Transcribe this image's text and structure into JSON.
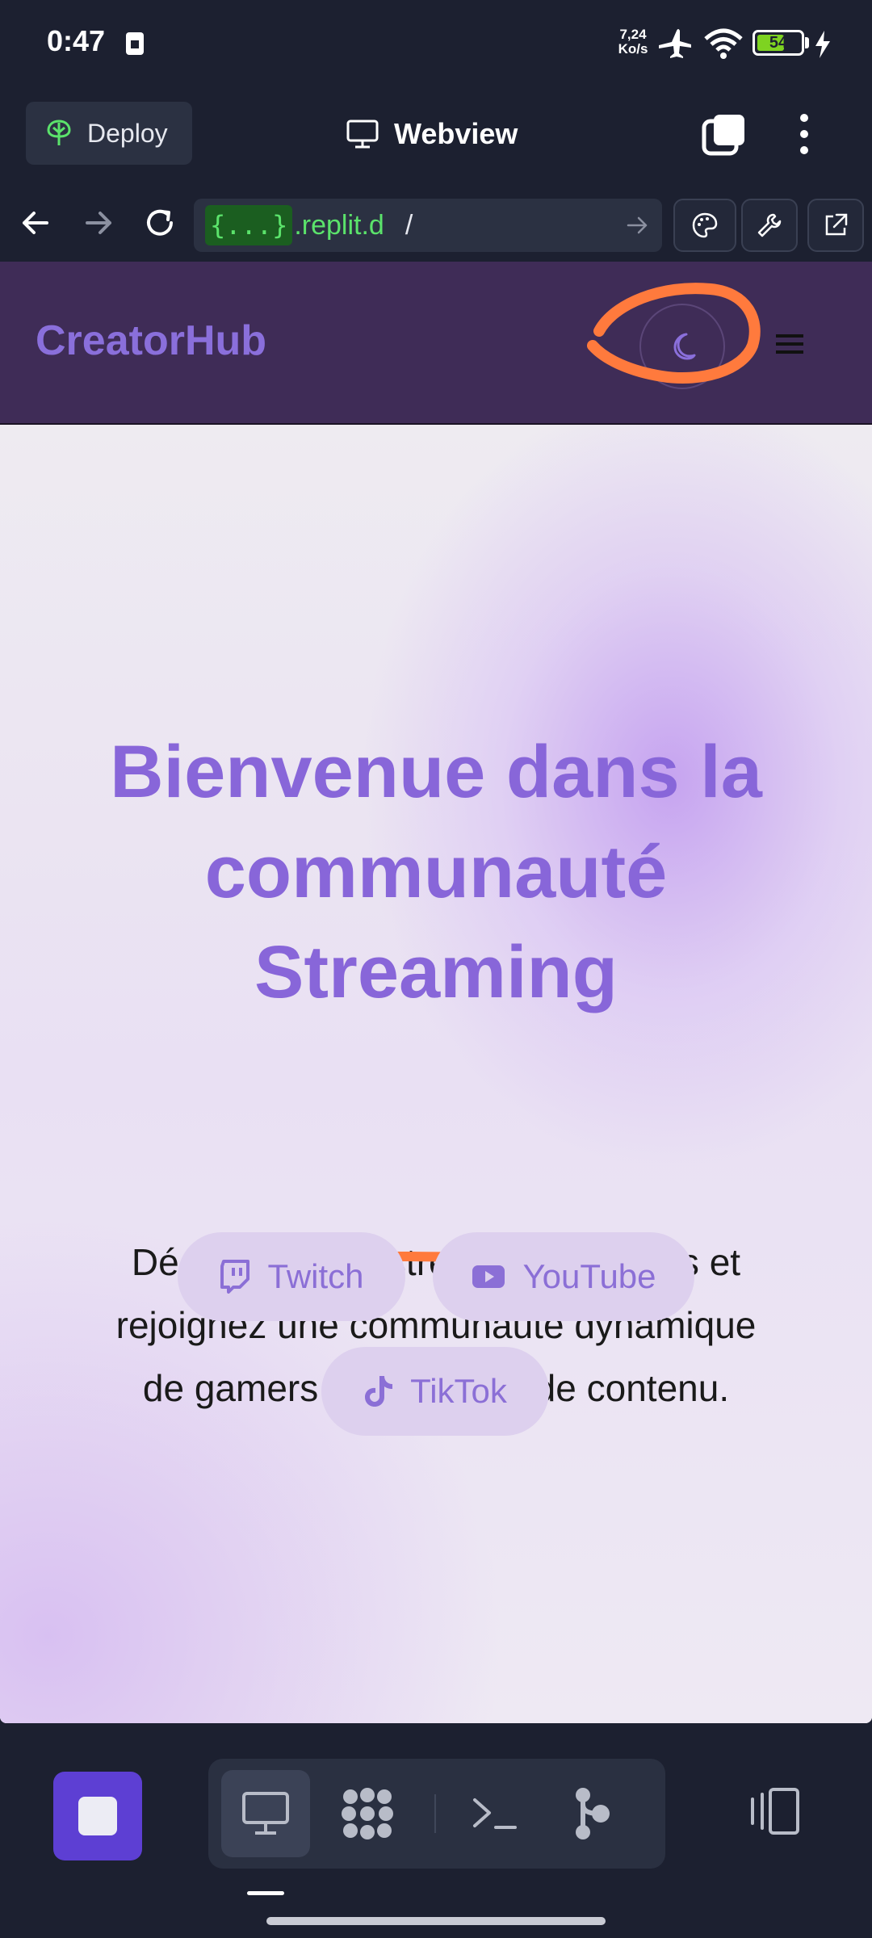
{
  "status_bar": {
    "time": "0:47",
    "net_speed_value": "7,24",
    "net_speed_unit": "Ko/s",
    "battery": "54"
  },
  "app_bar": {
    "deploy_label": "Deploy",
    "title": "Webview"
  },
  "url_bar": {
    "url_tag": "{...}",
    "url_host": ".replit.d",
    "url_path": "/"
  },
  "site": {
    "logo": "CreatorHub",
    "hero_title_lines": [
      "Bienvenue dans la",
      "communauté",
      "Streaming"
    ],
    "hero_text_lines": [
      "Découvrez vos streamers préférés et",
      "rejoignez une communauté dynamique",
      "de gamers et créateurs de contenu."
    ],
    "social": {
      "twitch": "Twitch",
      "youtube": "YouTube",
      "tiktok": "TikTok"
    }
  },
  "colors": {
    "accent_purple": "#8866d9",
    "nav_bg": "#3f2c57",
    "replit_stop": "#5d3fd3",
    "annotation_orange": "#ff7a3d"
  }
}
